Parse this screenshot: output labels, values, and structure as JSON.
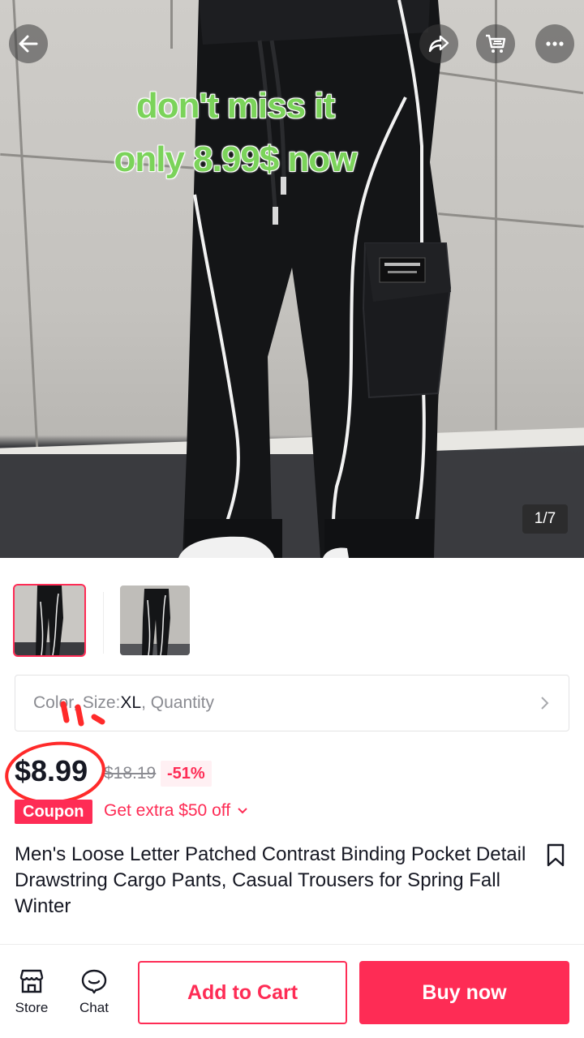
{
  "hero": {
    "overlay_line1": "don't miss it",
    "overlay_line2": "only 8.99$ now",
    "image_counter": "1/7",
    "icons": [
      "back-arrow-icon",
      "share-icon",
      "cart-icon",
      "more-icon"
    ]
  },
  "thumbnails": [
    {
      "selected": true
    },
    {
      "selected": false
    }
  ],
  "variant": {
    "label_prefix": "Color, Size: ",
    "size_value": "XL",
    "label_suffix": ", Quantity"
  },
  "price": {
    "current": "$8.99",
    "original": "$18.19",
    "discount": "-51%"
  },
  "coupon": {
    "badge": "Coupon",
    "offer": "Get extra $50 off"
  },
  "product": {
    "title": "Men's Loose Letter Patched Contrast Binding Pocket Detail Drawstring Cargo Pants, Casual Trousers for Spring Fall Winter"
  },
  "bottom_bar": {
    "store_label": "Store",
    "chat_label": "Chat",
    "add_to_cart_label": "Add to Cart",
    "buy_now_label": "Buy now"
  },
  "colors": {
    "accent": "#fe2c55",
    "overlay_text": "#7bd35a",
    "text_primary": "#161823",
    "text_secondary": "#8a8b91"
  }
}
